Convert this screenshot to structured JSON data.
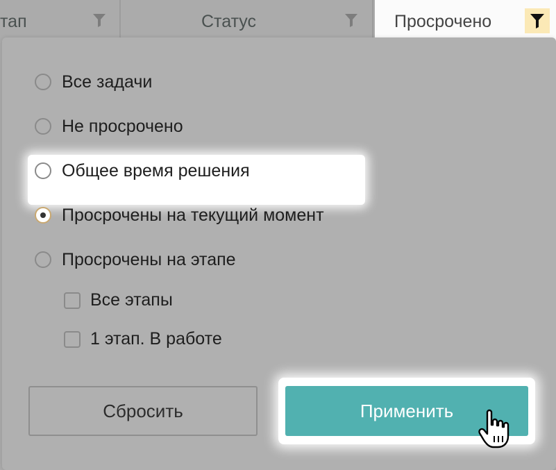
{
  "header": {
    "col1_label": "тап",
    "col2_label": "Статус",
    "col3_label": "Просрочено"
  },
  "filter": {
    "options": [
      {
        "label": "Все задачи",
        "selected": false
      },
      {
        "label": "Не просрочено",
        "selected": false
      },
      {
        "label": "Общее время решения",
        "selected": false
      },
      {
        "label": "Просрочены на текущий момент",
        "selected": true
      },
      {
        "label": "Просрочены на этапе",
        "selected": false
      }
    ],
    "stage_checkboxes": [
      {
        "label": "Все этапы",
        "checked": false
      },
      {
        "label": "1 этап. В работе",
        "checked": false
      }
    ],
    "reset_label": "Сбросить",
    "apply_label": "Применить"
  },
  "colors": {
    "accent": "#51b1b0",
    "active_filter": "#fbe9b6",
    "overlay": "#ababab"
  }
}
